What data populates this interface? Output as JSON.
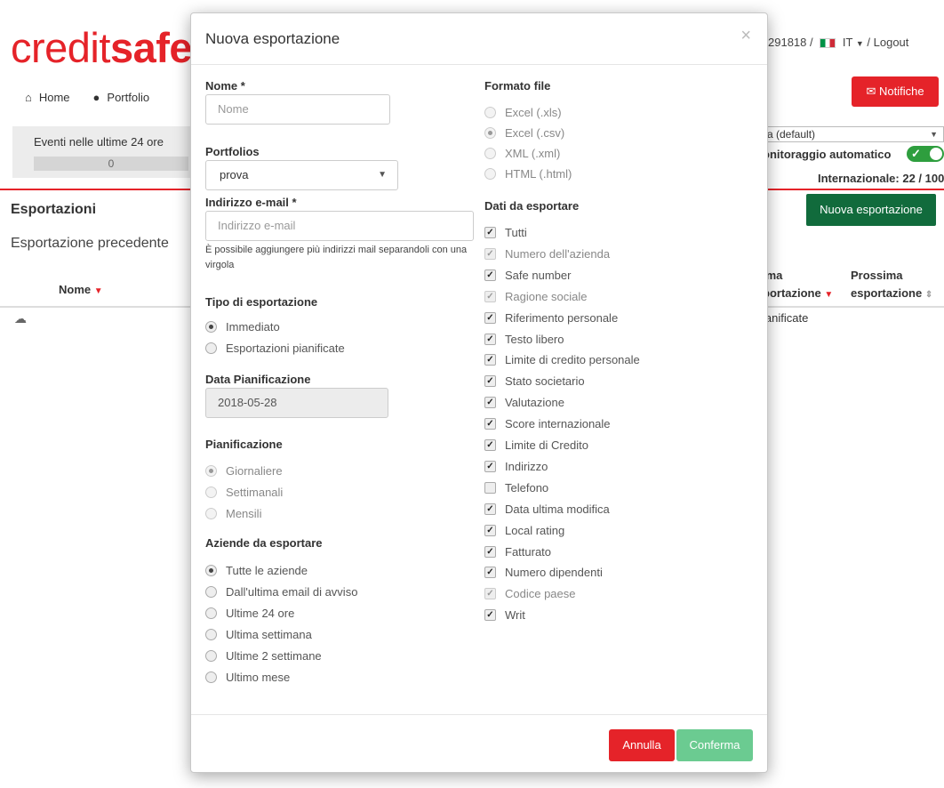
{
  "bg": {
    "logo_a": "credit",
    "logo_b": "safe",
    "nav": [
      {
        "label": "Home",
        "icon": "home-icon"
      },
      {
        "label": "Portfolio",
        "icon": "eye-icon"
      }
    ],
    "events_title": "Eventi nelle ultime 24 ore",
    "events_count": "0",
    "account_tail": "291818",
    "sep": "/",
    "lang": "IT",
    "logout": "Logout",
    "notifiche": "Notifiche",
    "select_default": "a (default)",
    "monitoraggio": "onitoraggio automatico",
    "internazionale": "Internazionale: 22 / 100",
    "nuova_button": "Nuova esportazione",
    "esportazioni": "Esportazioni",
    "esportazione_precedente": "Esportazione precedente",
    "col_nome": "Nome",
    "col_ultima_1": "ima",
    "col_ultima_2": "portazione",
    "col_prossima_1": "Prossima",
    "col_prossima_2": "esportazione",
    "pianificate": "ianificate"
  },
  "modal": {
    "title": "Nuova esportazione",
    "close": "×",
    "nome_label": "Nome *",
    "nome_placeholder": "Nome",
    "portfolios_label": "Portfolios",
    "portfolios_value": "prova",
    "email_label": "Indirizzo e-mail *",
    "email_placeholder": "Indirizzo e-mail",
    "email_help": "È possibile aggiungere più indirizzi mail separandoli con una virgola",
    "tipo_label": "Tipo di esportazione",
    "tipo_options": [
      {
        "label": "Immediato",
        "selected": true
      },
      {
        "label": "Esportazioni pianificate",
        "selected": false
      }
    ],
    "data_label": "Data Pianificazione",
    "data_value": "2018-05-28",
    "pianificazione_label": "Pianificazione",
    "pianificazione_options": [
      {
        "label": "Giornaliere",
        "selected": true
      },
      {
        "label": "Settimanali",
        "selected": false
      },
      {
        "label": "Mensili",
        "selected": false
      }
    ],
    "aziende_label": "Aziende da esportare",
    "aziende_options": [
      {
        "label": "Tutte le aziende",
        "selected": true
      },
      {
        "label": "Dall'ultima email di avviso",
        "selected": false
      },
      {
        "label": "Ultime 24 ore",
        "selected": false
      },
      {
        "label": "Ultima settimana",
        "selected": false
      },
      {
        "label": "Ultime 2 settimane",
        "selected": false
      },
      {
        "label": "Ultimo mese",
        "selected": false
      }
    ],
    "formato_label": "Formato file",
    "formato_options": [
      {
        "label": "Excel (.xls)",
        "selected": false
      },
      {
        "label": "Excel (.csv)",
        "selected": true
      },
      {
        "label": "XML (.xml)",
        "selected": false
      },
      {
        "label": "HTML (.html)",
        "selected": false
      }
    ],
    "dati_label": "Dati da esportare",
    "dati_options": [
      {
        "label": "Tutti",
        "checked": true,
        "disabled": false
      },
      {
        "label": "Numero dell'azienda",
        "checked": true,
        "disabled": true
      },
      {
        "label": "Safe number",
        "checked": true,
        "disabled": false
      },
      {
        "label": "Ragione sociale",
        "checked": true,
        "disabled": true
      },
      {
        "label": "Riferimento personale",
        "checked": true,
        "disabled": false
      },
      {
        "label": "Testo libero",
        "checked": true,
        "disabled": false
      },
      {
        "label": "Limite di credito personale",
        "checked": true,
        "disabled": false
      },
      {
        "label": "Stato societario",
        "checked": true,
        "disabled": false
      },
      {
        "label": "Valutazione",
        "checked": true,
        "disabled": false
      },
      {
        "label": "Score internazionale",
        "checked": true,
        "disabled": false
      },
      {
        "label": "Limite di Credito",
        "checked": true,
        "disabled": false
      },
      {
        "label": "Indirizzo",
        "checked": true,
        "disabled": false
      },
      {
        "label": "Telefono",
        "checked": false,
        "disabled": false
      },
      {
        "label": "Data ultima modifica",
        "checked": true,
        "disabled": false
      },
      {
        "label": "Local rating",
        "checked": true,
        "disabled": false
      },
      {
        "label": "Fatturato",
        "checked": true,
        "disabled": false
      },
      {
        "label": "Numero dipendenti",
        "checked": true,
        "disabled": false
      },
      {
        "label": "Codice paese",
        "checked": true,
        "disabled": true
      },
      {
        "label": "Writ",
        "checked": true,
        "disabled": false
      }
    ],
    "annulla": "Annulla",
    "conferma": "Conferma"
  },
  "colors": {
    "brand_red": "#e52329",
    "green_dark": "#116b3c",
    "confirm_green": "#6bcb91"
  }
}
